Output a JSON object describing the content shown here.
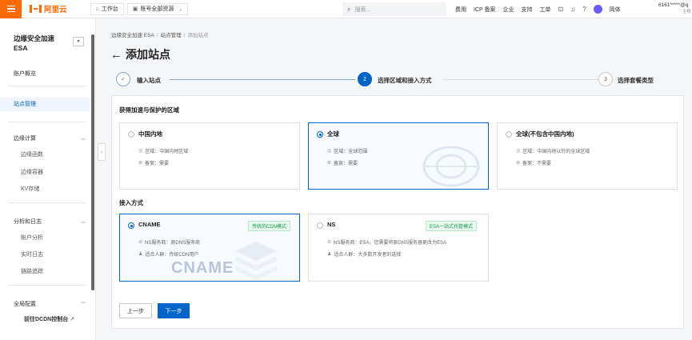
{
  "topbar": {
    "logo_text": "阿里云",
    "workbench": "工作台",
    "account_scope": "账号全部资源",
    "search_placeholder": "搜索...",
    "links": [
      "费用",
      "ICP 备案",
      "企业",
      "支持",
      "工单"
    ],
    "lang": "简体",
    "account_name": "6161*****@q",
    "account_sub": "主账"
  },
  "sidebar": {
    "title_line1": "边缘安全加速",
    "title_line2": "ESA",
    "overview": "账户概览",
    "site_mgmt": "站点管理",
    "edge_compute": {
      "label": "边缘计算",
      "items": [
        "边缘函数",
        "边缘容器",
        "KV存储"
      ]
    },
    "analytics": {
      "label": "分析和日志",
      "items": [
        "账户分析",
        "实时日志",
        "链路追踪"
      ]
    },
    "global_config": "全局配置",
    "footer_link": "前往DCDN控制台"
  },
  "breadcrumb": [
    "边缘安全加速 ESA",
    "站点管理",
    "添加站点"
  ],
  "page_title": "添加站点",
  "steps": [
    {
      "num": "✓",
      "label": "输入站点",
      "state": "done"
    },
    {
      "num": "2",
      "label": "选择区域和接入方式",
      "state": "active"
    },
    {
      "num": "3",
      "label": "选择套餐类型",
      "state": "todo"
    }
  ],
  "region_section": {
    "title": "获得加速与保护的区域",
    "options": [
      {
        "title": "中国内地",
        "region": "区域：中国内地区域",
        "icp": "备案：需要",
        "selected": false
      },
      {
        "title": "全球",
        "region": "区域：全球范围",
        "icp": "备案：需要",
        "selected": true
      },
      {
        "title": "全球(不包含中国内地)",
        "region": "区域：中国内地以外的全球区域",
        "icp": "备案：不需要",
        "selected": false
      }
    ]
  },
  "access_section": {
    "title": "接入方式",
    "options": [
      {
        "title": "CNAME",
        "tag": "传统的CDN模式",
        "ns": "NS服务商：原DNS服务商",
        "audience": "适合人群：传统CDN用户",
        "watermark": "CNAME",
        "selected": true
      },
      {
        "title": "NS",
        "tag": "ESA一站式托管模式",
        "ns": "NS服务商：ESA，您需要将原DNS服务器更改为ESA",
        "audience": "适合人群：大多数开发者的选择",
        "selected": false
      }
    ]
  },
  "buttons": {
    "prev": "上一步",
    "next": "下一步"
  },
  "colors": {
    "accent": "#0064c8",
    "brand": "#ff6a00",
    "tag_green": "#1b9a4b"
  }
}
